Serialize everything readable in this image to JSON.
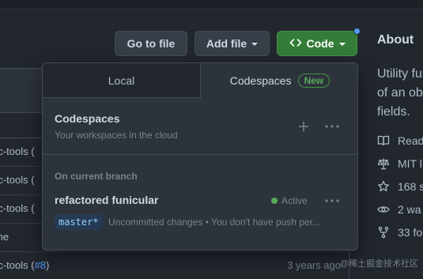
{
  "toolbar": {
    "go_to_file": "Go to file",
    "add_file": "Add file",
    "code": "Code"
  },
  "file_list": {
    "rows": [
      {
        "name": "rc-tools (",
        "time": ""
      },
      {
        "name": "rc-tools (",
        "time": ""
      },
      {
        "name": "rc-tools (",
        "time": ""
      },
      {
        "name": "me",
        "time": ""
      },
      {
        "name": "rc-tools (",
        "link": "#8",
        "suffix": ")",
        "time": "3 years ago"
      }
    ]
  },
  "about": {
    "title": "About",
    "description_lines": [
      "Utility fu",
      "of an ob",
      "fields."
    ],
    "meta": [
      {
        "icon": "book-icon",
        "label": "Read"
      },
      {
        "icon": "scale-icon",
        "label": "MIT l"
      },
      {
        "icon": "star-icon",
        "label": "168 s"
      },
      {
        "icon": "eye-icon",
        "label": "2 wa"
      },
      {
        "icon": "fork-icon",
        "label": "33 fo"
      }
    ]
  },
  "dropdown": {
    "tabs": {
      "local": "Local",
      "codespaces": "Codespaces",
      "new_badge": "New"
    },
    "codespaces_header": {
      "title": "Codespaces",
      "subtitle": "Your workspaces in the cloud"
    },
    "section_label": "On current branch",
    "codespace": {
      "name": "refactored funicular",
      "status": "Active",
      "branch": "master*",
      "detail": "Uncommitted changes  •  You don't have push per..."
    }
  },
  "watermark": "@稀土掘金技术社区",
  "colors": {
    "accent_green": "#347d39",
    "link_blue": "#539bf5",
    "status_green": "#57ab5a"
  }
}
